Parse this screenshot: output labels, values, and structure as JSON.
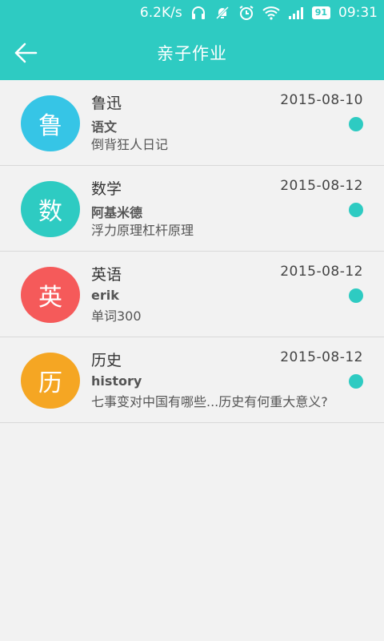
{
  "status_bar": {
    "speed": "6.2K/s",
    "battery": "91",
    "time": "09:31",
    "icons": [
      "headphones-icon",
      "notification-off-icon",
      "alarm-icon",
      "wifi-icon",
      "signal-icon",
      "battery-icon"
    ]
  },
  "header": {
    "title": "亲子作业",
    "back_icon": "back-arrow-icon"
  },
  "colors": {
    "accent": "#2ecbc2",
    "dot": "#2ecbc2"
  },
  "items": [
    {
      "avatar_char": "鲁",
      "avatar_color": "#36c5e6",
      "subject": "鲁迅",
      "date": "2015-08-10",
      "author": "语文",
      "content": "倒背狂人日记"
    },
    {
      "avatar_char": "数",
      "avatar_color": "#2ecbc2",
      "subject": "数学",
      "date": "2015-08-12",
      "author": "阿基米德",
      "content": "浮力原理杠杆原理"
    },
    {
      "avatar_char": "英",
      "avatar_color": "#f55a5a",
      "subject": "英语",
      "date": "2015-08-12",
      "author": "erik",
      "content": "单词300"
    },
    {
      "avatar_char": "历",
      "avatar_color": "#f5a623",
      "subject": "历史",
      "date": "2015-08-12",
      "author": "history",
      "content": "七事变对中国有哪些...历史有何重大意义?"
    }
  ]
}
